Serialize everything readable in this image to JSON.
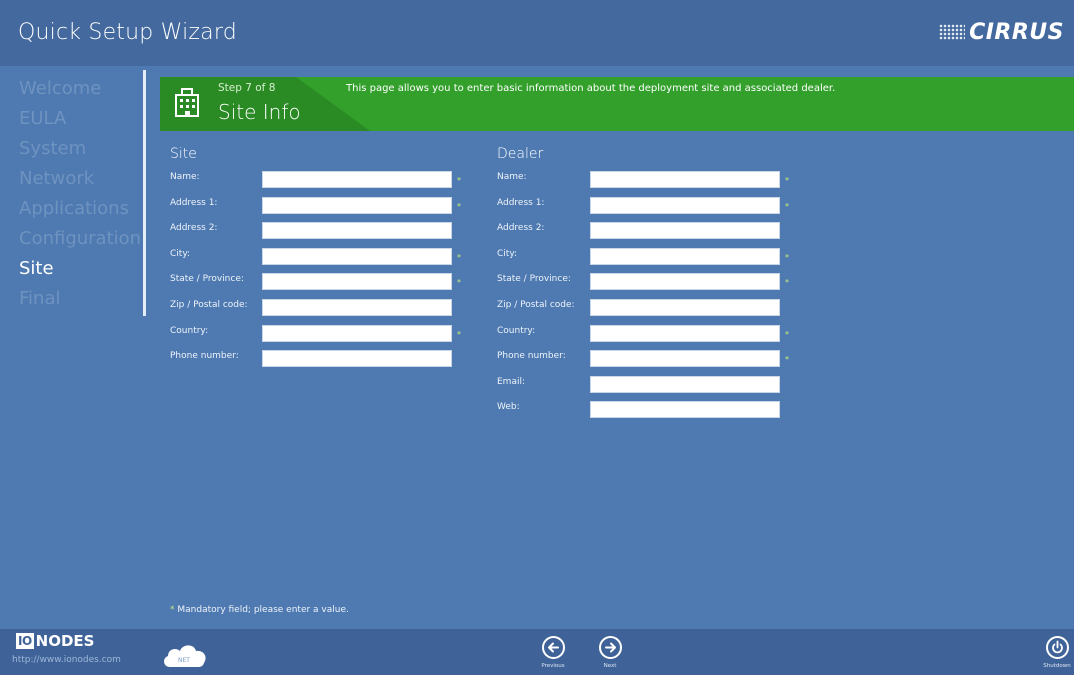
{
  "app": {
    "title": "Quick Setup Wizard",
    "brand": "CIRRUS"
  },
  "nav": {
    "items": [
      {
        "label": "Welcome"
      },
      {
        "label": "EULA"
      },
      {
        "label": "System"
      },
      {
        "label": "Network"
      },
      {
        "label": "Applications"
      },
      {
        "label": "Configuration"
      },
      {
        "label": "Site"
      },
      {
        "label": "Final"
      }
    ],
    "active": "Site"
  },
  "banner": {
    "step": "Step 7 of 8",
    "title": "Site Info",
    "description": "This page allows you to enter basic information about the deployment site and associated dealer.",
    "icon": "building-icon"
  },
  "site": {
    "heading": "Site",
    "fields": [
      {
        "label": "Name:",
        "value": "",
        "mandatory": true
      },
      {
        "label": "Address 1:",
        "value": "",
        "mandatory": true
      },
      {
        "label": "Address 2:",
        "value": "",
        "mandatory": false
      },
      {
        "label": "City:",
        "value": "",
        "mandatory": true
      },
      {
        "label": "State / Province:",
        "value": "",
        "mandatory": true
      },
      {
        "label": "Zip / Postal code:",
        "value": "",
        "mandatory": false
      },
      {
        "label": "Country:",
        "value": "",
        "mandatory": true
      },
      {
        "label": "Phone number:",
        "value": "",
        "mandatory": false
      }
    ]
  },
  "dealer": {
    "heading": "Dealer",
    "fields": [
      {
        "label": "Name:",
        "value": "",
        "mandatory": true
      },
      {
        "label": "Address 1:",
        "value": "",
        "mandatory": true
      },
      {
        "label": "Address 2:",
        "value": "",
        "mandatory": false
      },
      {
        "label": "City:",
        "value": "",
        "mandatory": true
      },
      {
        "label": "State / Province:",
        "value": "",
        "mandatory": true
      },
      {
        "label": "Zip / Postal code:",
        "value": "",
        "mandatory": false
      },
      {
        "label": "Country:",
        "value": "",
        "mandatory": true
      },
      {
        "label": "Phone number:",
        "value": "",
        "mandatory": true
      },
      {
        "label": "Email:",
        "value": "",
        "mandatory": false
      },
      {
        "label": "Web:",
        "value": "",
        "mandatory": false
      }
    ]
  },
  "mandatory_marker": "*",
  "mandatory_note": "Mandatory field; please enter a value.",
  "footer": {
    "logo_box": "IO",
    "logo_text": "NODES",
    "url": "http://www.ionodes.com",
    "cloud_label": "NET",
    "previous_label": "Previous",
    "next_label": "Next",
    "shutdown_label": "Shutdown"
  },
  "colors": {
    "background": "#4e7ab1",
    "titlebar": "#44699e",
    "banner_green": "#33a02c",
    "mandatory_star": "#c7e97a"
  }
}
